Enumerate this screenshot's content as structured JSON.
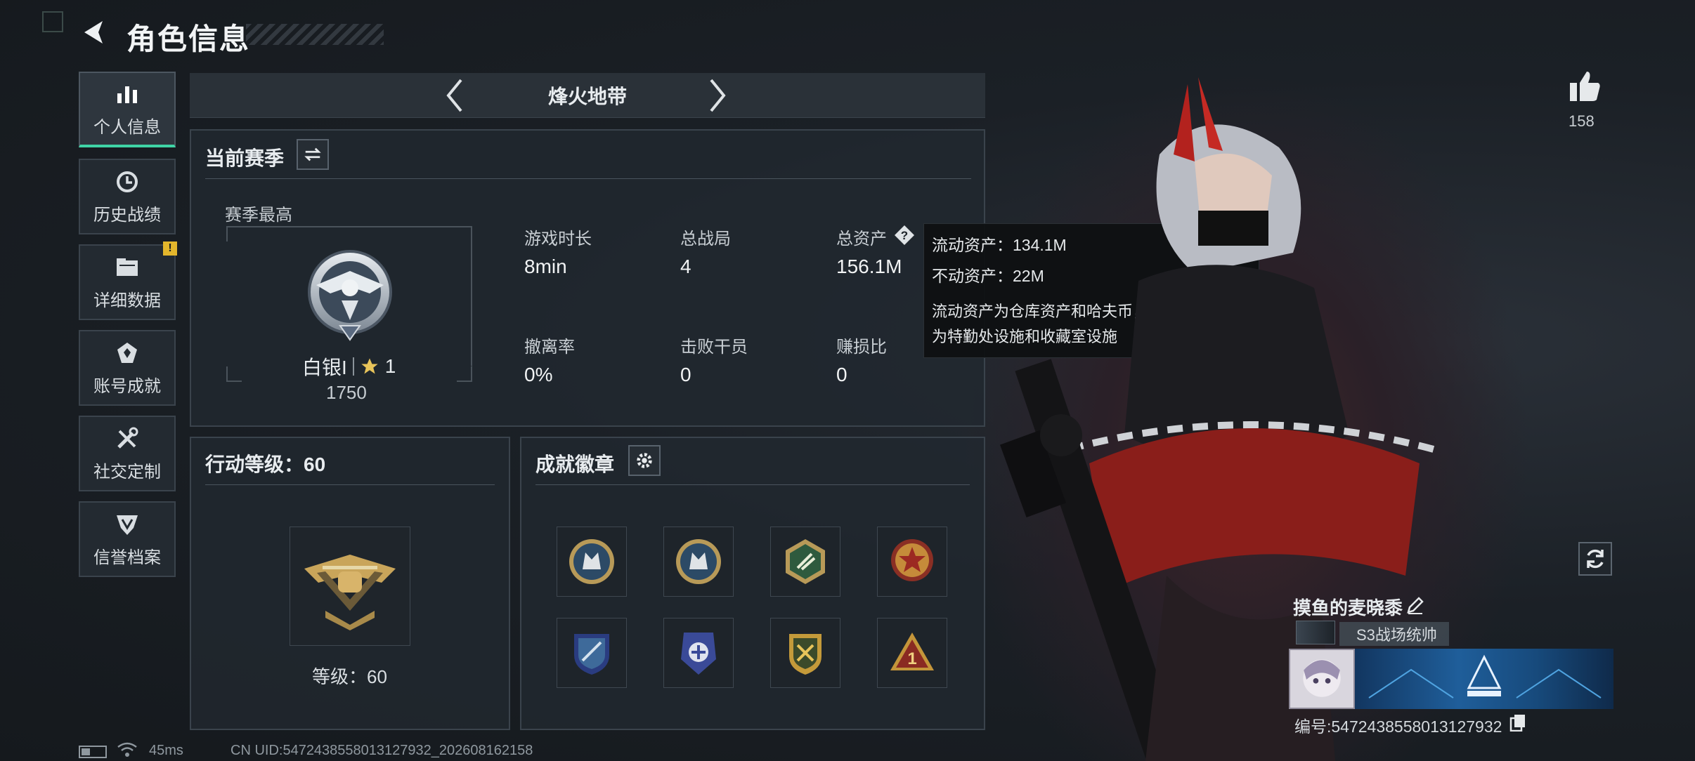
{
  "header": {
    "title": "角色信息"
  },
  "sidebar": {
    "items": [
      {
        "label": "个人信息",
        "icon": "bar-chart-icon",
        "active": true
      },
      {
        "label": "历史战绩",
        "icon": "history-clock-icon"
      },
      {
        "label": "详细数据",
        "icon": "folder-icon",
        "badge": "!"
      },
      {
        "label": "账号成就",
        "icon": "achievement-emblem-icon"
      },
      {
        "label": "社交定制",
        "icon": "tools-icon"
      },
      {
        "label": "信誉档案",
        "icon": "reputation-shield-icon"
      }
    ]
  },
  "mode_selector": {
    "current": "烽火地带"
  },
  "season_panel": {
    "title": "当前赛季",
    "best_label": "赛季最高",
    "rank_name": "白银I",
    "rank_stars": "1",
    "rank_points": "1750",
    "stats": [
      {
        "label": "游戏时长",
        "value": "8min"
      },
      {
        "label": "总战局",
        "value": "4"
      },
      {
        "label": "总资产",
        "value": "156.1M"
      },
      {
        "label": "撤离率",
        "value": "0%"
      },
      {
        "label": "击败干员",
        "value": "0"
      },
      {
        "label": "赚损比",
        "value": "0"
      }
    ]
  },
  "tooltip": {
    "liquid": "流动资产：134.1M",
    "fixed": "不动资产：22M",
    "desc_line1": "流动资产为仓库资产和哈夫币，不动资产",
    "desc_line2": "为特勤处设施和收藏室设施"
  },
  "level_panel": {
    "title": "行动等级：60",
    "level_text": "等级：60"
  },
  "badges_panel": {
    "title": "成就徽章",
    "badges": [
      "wolf-badge-icon",
      "wolf-badge-icon",
      "hex-badge-icon",
      "star-badge-icon",
      "shield-badge-icon",
      "police-badge-icon",
      "gold-badge-icon",
      "rank-one-badge-icon"
    ]
  },
  "profile": {
    "likes": "158",
    "nickname": "摸鱼的麦晓黍",
    "title_tag": "S3战场统帅",
    "uid": "编号:5472438558013127932"
  },
  "status_bar": {
    "ping": "45ms",
    "uid": "CN UID:5472438558013127932_202608162158"
  },
  "colors": {
    "accent": "#3fd4a6",
    "warn": "#e3b62c"
  }
}
